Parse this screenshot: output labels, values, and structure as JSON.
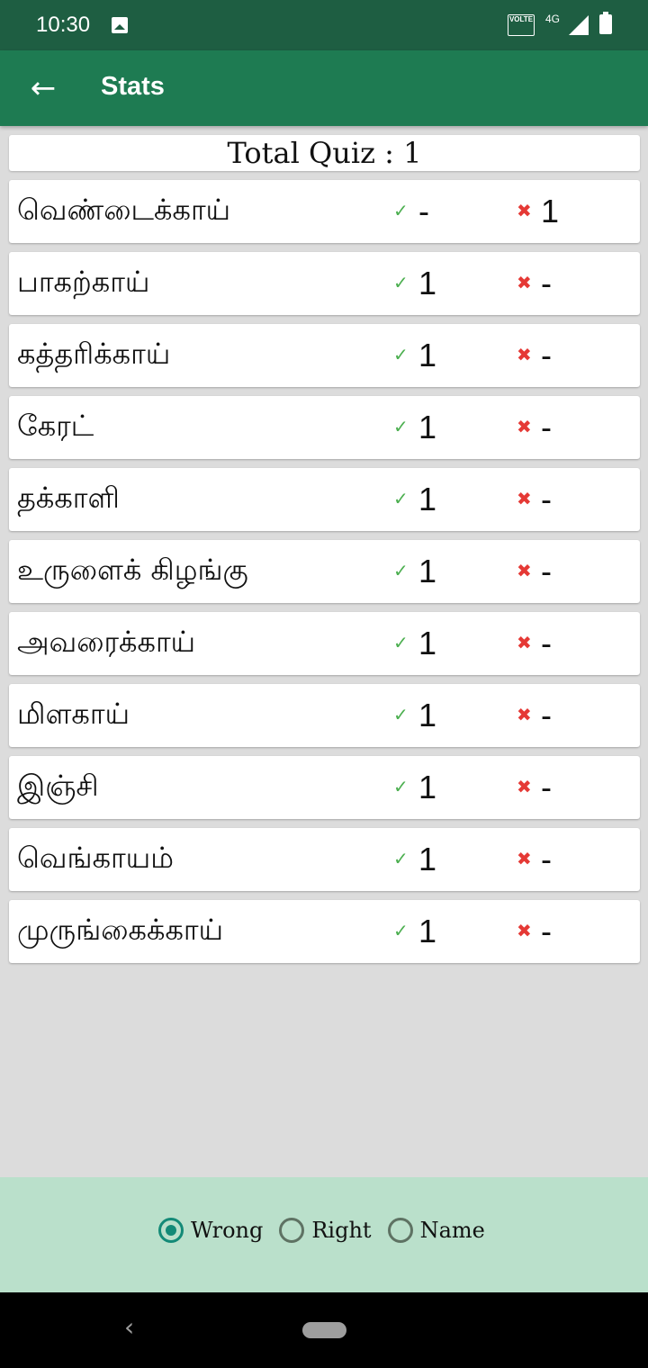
{
  "status_bar": {
    "time": "10:30",
    "volte": "VOLTE",
    "network": "4G"
  },
  "app_bar": {
    "title": "Stats",
    "back_icon": "arrow-left-icon"
  },
  "summary": {
    "total_label": "Total Quiz : 1"
  },
  "icons": {
    "right": "✓",
    "wrong": "✖"
  },
  "colors": {
    "statusbar": "#1e5e42",
    "appbar": "#1e7b52",
    "check": "#4caf50",
    "cross": "#e53935",
    "bottom_panel": "#bae0cb",
    "radio_accent": "#138a77"
  },
  "rows": [
    {
      "name": "வெண்டைக்காய்",
      "right": "-",
      "wrong": "1"
    },
    {
      "name": "பாகற்காய்",
      "right": "1",
      "wrong": "-"
    },
    {
      "name": "கத்தரிக்காய்",
      "right": "1",
      "wrong": "-"
    },
    {
      "name": "கேரட்",
      "right": "1",
      "wrong": "-"
    },
    {
      "name": "தக்காளி",
      "right": "1",
      "wrong": "-"
    },
    {
      "name": "உருளைக் கிழங்கு",
      "right": "1",
      "wrong": "-"
    },
    {
      "name": "அவரைக்காய்",
      "right": "1",
      "wrong": "-"
    },
    {
      "name": "மிளகாய்",
      "right": "1",
      "wrong": "-"
    },
    {
      "name": "இஞ்சி",
      "right": "1",
      "wrong": "-"
    },
    {
      "name": "வெங்காயம்",
      "right": "1",
      "wrong": "-"
    },
    {
      "name": "முருங்கைக்காய்",
      "right": "1",
      "wrong": "-"
    }
  ],
  "sort_options": [
    {
      "label": "Wrong",
      "checked": true
    },
    {
      "label": "Right",
      "checked": false
    },
    {
      "label": "Name",
      "checked": false
    }
  ],
  "nav": {
    "back": "‹"
  }
}
